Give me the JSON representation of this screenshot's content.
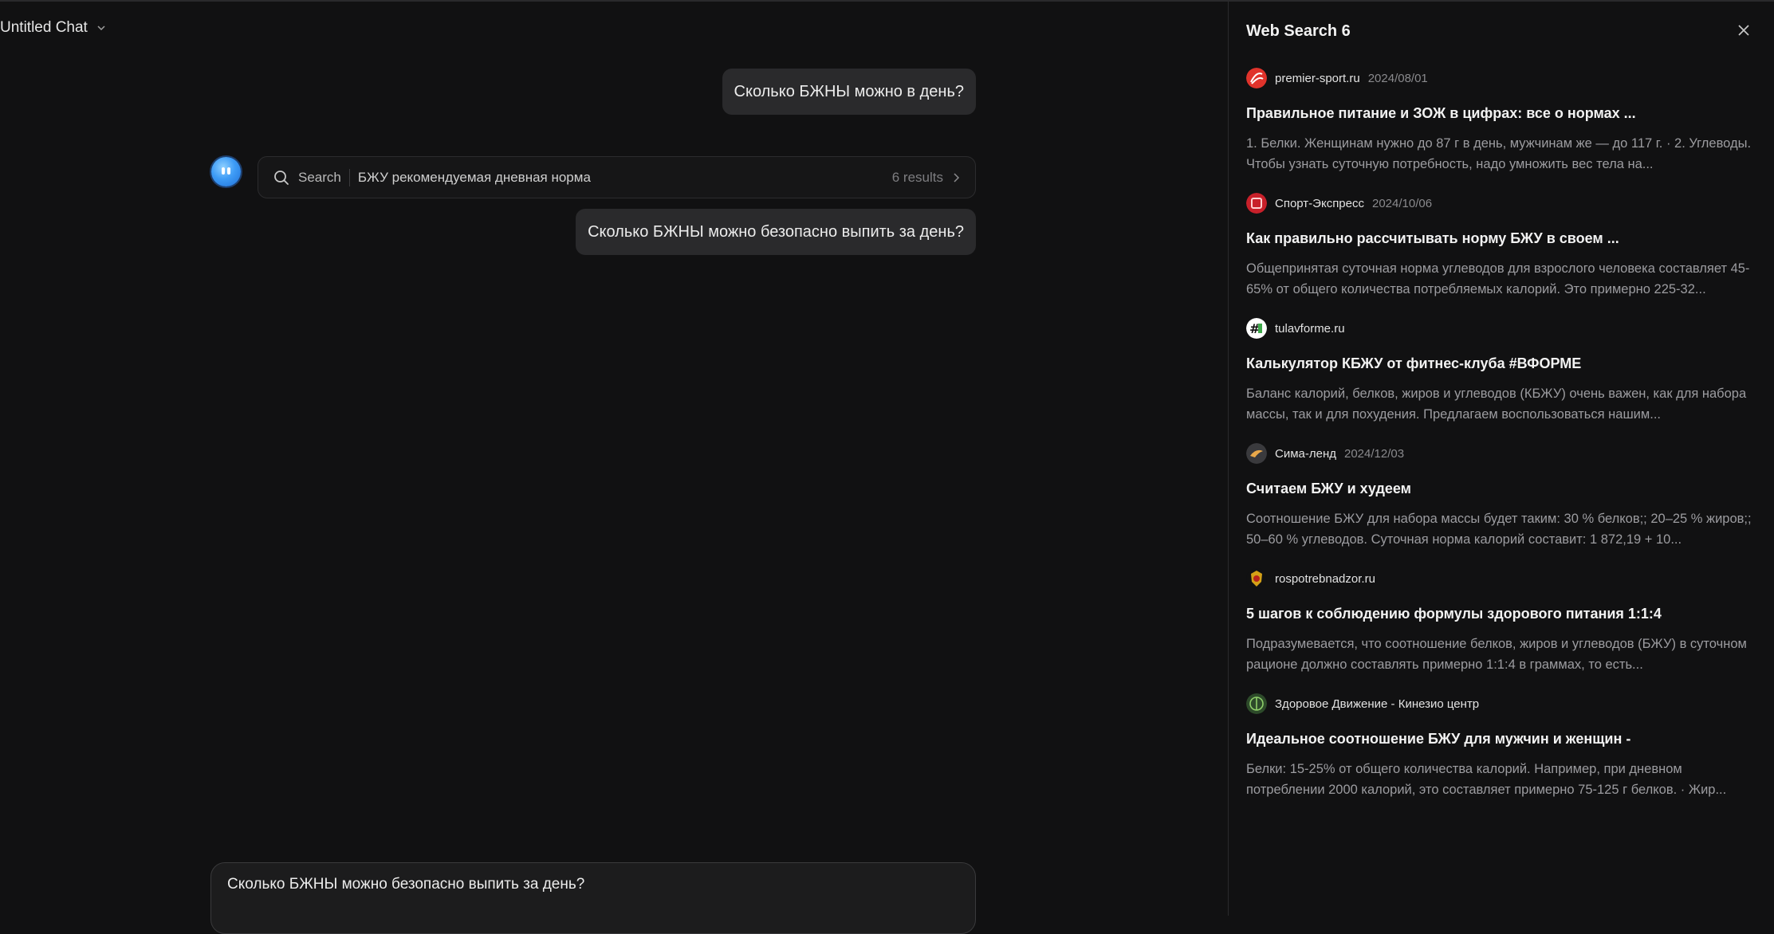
{
  "chat": {
    "title": "Untitled Chat",
    "messages": [
      "Сколько БЖНЫ можно в день?",
      "Сколько БЖНЫ можно безопасно выпить за день?"
    ],
    "search": {
      "label": "Search",
      "query": "БЖУ рекомендуемая дневная норма",
      "count": "6 results"
    },
    "composer_text": "Сколько БЖНЫ можно безопасно выпить за день?"
  },
  "panel": {
    "title": "Web Search 6",
    "results": [
      {
        "source": "premier-sport.ru",
        "date": "2024/08/01",
        "title": "Правильное питание и ЗОЖ в цифрах: все о нормах ...",
        "desc": "1. Белки. Женщинам нужно до 87 г в день, мужчинам же — до 117 г. · 2. Углеводы. Чтобы узнать суточную потребность, надо умножить вес тела на...",
        "icon": "premier-sport-favicon",
        "color": "#e0332b"
      },
      {
        "source": "Спорт-Экспресс",
        "date": "2024/10/06",
        "title": "Как правильно рассчитывать норму БЖУ в своем ...",
        "desc": "Общепринятая суточная норма углеводов для взрослого человека составляет 45-65% от общего количества потребляемых калорий. Это примерно 225-32...",
        "icon": "sport-express-favicon",
        "color": "#c8202a"
      },
      {
        "source": "tulavforme.ru",
        "date": "",
        "title": "Калькулятор КБЖУ от фитнес-клуба #ВФОРМЕ",
        "desc": "Баланс калорий, белков, жиров и углеводов (КБЖУ) очень важен, как для набора массы, так и для похудения. Предлагаем воспользоваться нашим...",
        "icon": "tulavforme-favicon",
        "color": "#ffffff"
      },
      {
        "source": "Сима-ленд",
        "date": "2024/12/03",
        "title": "Считаем БЖУ и худеем",
        "desc": "Соотношение БЖУ для набора массы будет таким: 30 % белков;; 20–25 % жиров;; 50–60 % углеводов. Суточная норма калорий составит: 1 872,19 + 10...",
        "icon": "sima-land-favicon",
        "color": "#3a3a3d"
      },
      {
        "source": "rospotrebnadzor.ru",
        "date": "",
        "title": "5 шагов к соблюдению формулы здорового питания 1:1:4",
        "desc": "Подразумевается, что соотношение белков, жиров и углеводов (БЖУ) в суточном рационе должно составлять примерно 1:1:4 в граммах, то есть...",
        "icon": "rospotrebnadzor-favicon",
        "color": "#d4a017"
      },
      {
        "source": "Здоровое Движение - Кинезио центр",
        "date": "",
        "title": "Идеальное соотношение БЖУ для мужчин и женщин -",
        "desc": "Белки: 15-25% от общего количества калорий. Например, при дневном потреблении 2000 калорий, это составляет примерно 75-125 г белков. · Жир...",
        "icon": "kinesio-favicon",
        "color": "#2d4a2a"
      }
    ]
  }
}
